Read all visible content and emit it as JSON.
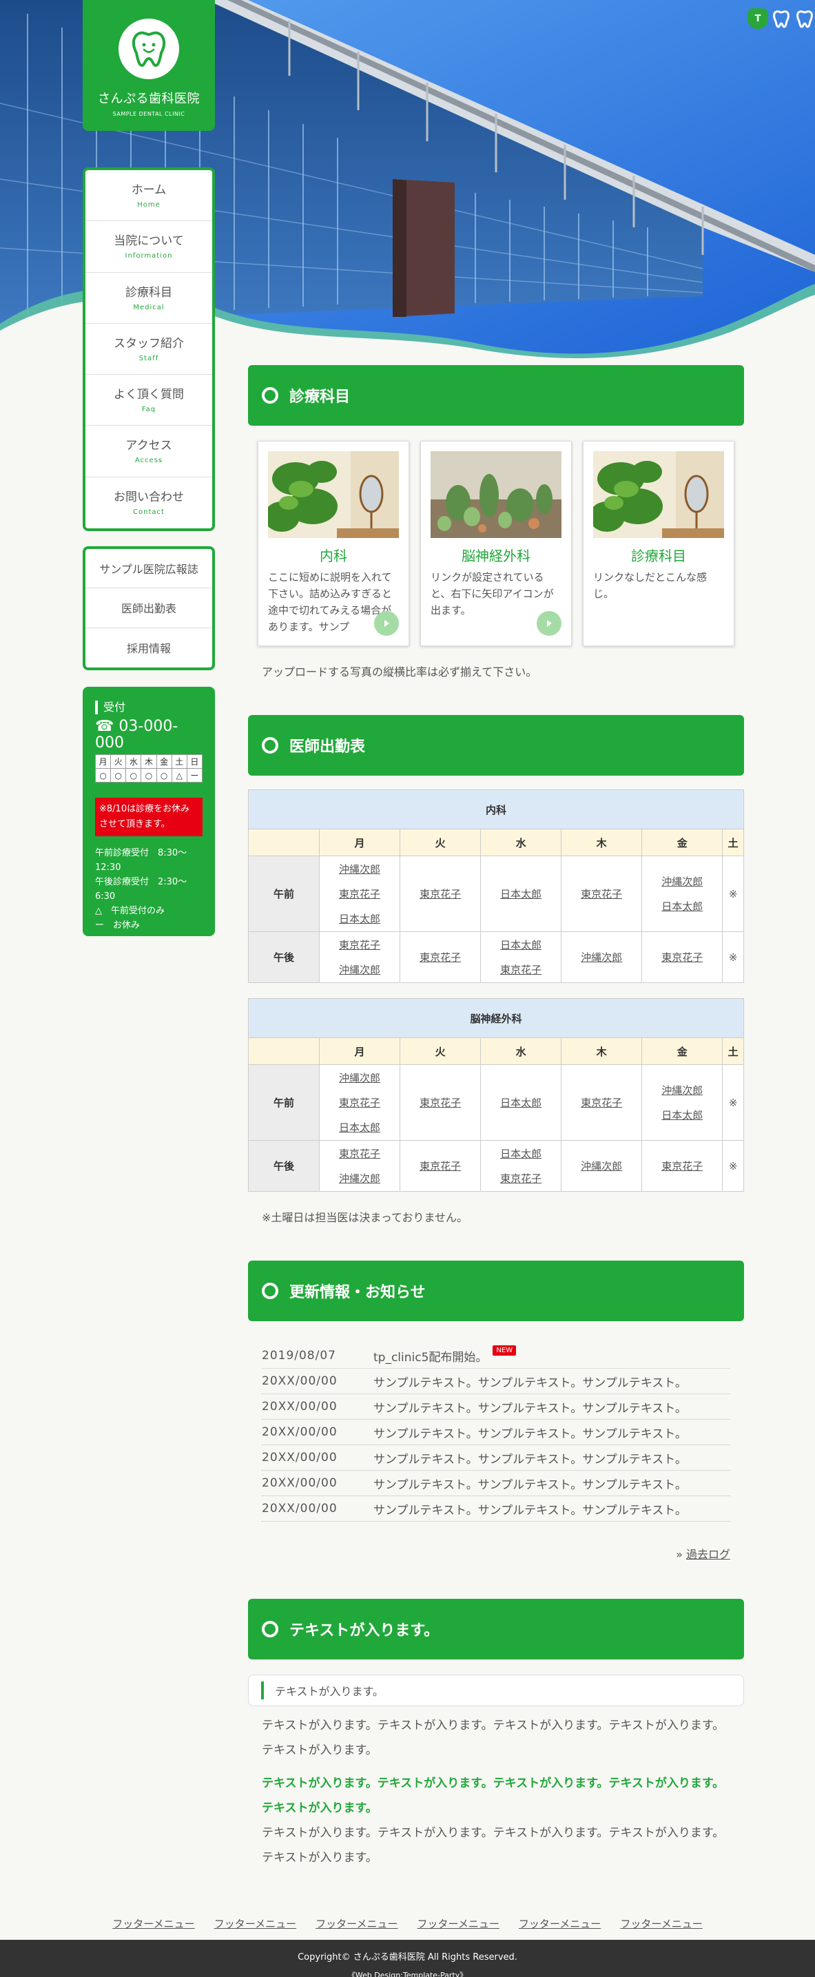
{
  "site": {
    "name": "さんぷる歯科医院",
    "subname": "SAMPLE DENTAL CLINIC"
  },
  "corner_tools": [
    {
      "label": "T",
      "name": "text-size-normal"
    },
    {
      "label": "",
      "name": "text-size-medium"
    },
    {
      "label": "",
      "name": "text-size-large"
    }
  ],
  "gnav": [
    {
      "ja": "ホーム",
      "en": "Home"
    },
    {
      "ja": "当院について",
      "en": "Information"
    },
    {
      "ja": "診療科目",
      "en": "Medical"
    },
    {
      "ja": "スタッフ紹介",
      "en": "Staff"
    },
    {
      "ja": "よく頂く質問",
      "en": "Faq"
    },
    {
      "ja": "アクセス",
      "en": "Access"
    },
    {
      "ja": "お問い合わせ",
      "en": "Contact"
    }
  ],
  "subnav": [
    "サンプル医院広報誌",
    "医師出勤表",
    "採用情報"
  ],
  "hours": {
    "title": "受付",
    "tel": "☎ 03-000-000",
    "days": [
      "月",
      "火",
      "水",
      "木",
      "金",
      "土",
      "日"
    ],
    "marks": [
      "○",
      "○",
      "○",
      "○",
      "○",
      "△",
      "ー"
    ],
    "alert": "※8/10は診療をお休みさせて頂きます。",
    "notes": [
      "午前診療受付　8:30〜12:30",
      "午後診療受付　2:30〜6:30",
      "△　午前受付のみ",
      "ー　お休み"
    ]
  },
  "medical": {
    "heading": "診療科目",
    "cards": [
      {
        "title": "内科",
        "desc": "ここに短めに説明を入れて下さい。詰め込みすぎると途中で切れてみえる場合があります。サンプ"
      },
      {
        "title": "脳神経外科",
        "desc": "リンクが設定されていると、右下に矢印アイコンが出ます。"
      },
      {
        "title": "診療科目",
        "desc": "リンクなしだとこんな感じ。"
      }
    ],
    "note": "アップロードする写真の縦横比率は必ず揃えて下さい。"
  },
  "schedule": {
    "heading": "医師出勤表",
    "days": [
      "月",
      "火",
      "水",
      "木",
      "金",
      "土"
    ],
    "am_label": "午前",
    "pm_label": "午後",
    "tables": [
      {
        "caption": "内科",
        "am": [
          [
            "沖縄次郎",
            "東京花子",
            "日本太郎"
          ],
          [
            "東京花子"
          ],
          [
            "日本太郎"
          ],
          [
            "東京花子"
          ],
          [
            "沖縄次郎",
            "日本太郎"
          ],
          [
            "※"
          ]
        ],
        "pm": [
          [
            "東京花子",
            "沖縄次郎"
          ],
          [
            "東京花子"
          ],
          [
            "日本太郎",
            "東京花子"
          ],
          [
            "沖縄次郎"
          ],
          [
            "東京花子"
          ],
          [
            "※"
          ]
        ]
      },
      {
        "caption": "脳神経外科",
        "am": [
          [
            "沖縄次郎",
            "東京花子",
            "日本太郎"
          ],
          [
            "東京花子"
          ],
          [
            "日本太郎"
          ],
          [
            "東京花子"
          ],
          [
            "沖縄次郎",
            "日本太郎"
          ],
          [
            "※"
          ]
        ],
        "pm": [
          [
            "東京花子",
            "沖縄次郎"
          ],
          [
            "東京花子"
          ],
          [
            "日本太郎",
            "東京花子"
          ],
          [
            "沖縄次郎"
          ],
          [
            "東京花子"
          ],
          [
            "※"
          ]
        ]
      }
    ],
    "note": "※土曜日は担当医は決まっておりません。"
  },
  "news": {
    "heading": "更新情報・お知らせ",
    "items": [
      {
        "date": "2019/08/07",
        "text": "tp_clinic5配布開始。",
        "badge": "NEW"
      },
      {
        "date": "20XX/00/00",
        "text": "サンプルテキスト。サンプルテキスト。サンプルテキスト。",
        "badge": ""
      },
      {
        "date": "20XX/00/00",
        "text": "サンプルテキスト。サンプルテキスト。サンプルテキスト。",
        "badge": ""
      },
      {
        "date": "20XX/00/00",
        "text": "サンプルテキスト。サンプルテキスト。サンプルテキスト。",
        "badge": ""
      },
      {
        "date": "20XX/00/00",
        "text": "サンプルテキスト。サンプルテキスト。サンプルテキスト。",
        "badge": ""
      },
      {
        "date": "20XX/00/00",
        "text": "サンプルテキスト。サンプルテキスト。サンプルテキスト。",
        "badge": ""
      },
      {
        "date": "20XX/00/00",
        "text": "サンプルテキスト。サンプルテキスト。サンプルテキスト。",
        "badge": ""
      }
    ],
    "more_prefix": "»",
    "more_label": "過去ログ"
  },
  "text_section": {
    "heading": "テキストが入ります。",
    "bubble": "テキストが入ります。",
    "para1": "テキストが入ります。テキストが入ります。テキストが入ります。テキストが入ります。テキストが入ります。",
    "para2": "テキストが入ります。テキストが入ります。テキストが入ります。テキストが入ります。テキストが入ります。",
    "para3": "テキストが入ります。テキストが入ります。テキストが入ります。テキストが入ります。テキストが入ります。"
  },
  "footer": {
    "menu": [
      "フッターメニュー",
      "フッターメニュー",
      "フッターメニュー",
      "フッターメニュー",
      "フッターメニュー",
      "フッターメニュー"
    ],
    "copyright": "Copyright© さんぷる歯科医院 All Rights Reserved.",
    "credit": "《Web Design:Template-Party》"
  },
  "colors": {
    "brand": "#21a83a",
    "alert": "#e60012",
    "sky": "#2f7be0",
    "footer": "#333333"
  }
}
